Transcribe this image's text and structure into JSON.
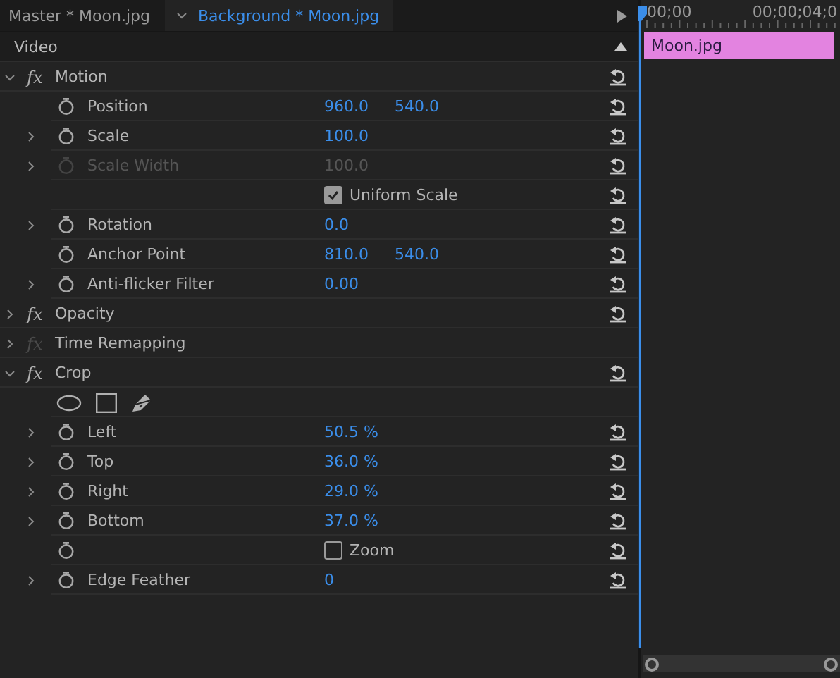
{
  "tabs": [
    {
      "label": "Master * Moon.jpg",
      "selected": false
    },
    {
      "label": "Background * Moon.jpg",
      "selected": true
    }
  ],
  "section": {
    "label": "Video"
  },
  "rows": [
    {
      "kind": "effect",
      "name": "Motion",
      "badge": "fx",
      "expanded": true,
      "fx_enabled": true,
      "reset": true
    },
    {
      "kind": "property",
      "name": "Position",
      "twirl": false,
      "values": [
        "960.0",
        "540.0"
      ],
      "reset": true
    },
    {
      "kind": "property",
      "name": "Scale",
      "twirl": true,
      "values": [
        "100.0"
      ],
      "reset": true
    },
    {
      "kind": "property",
      "name": "Scale Width",
      "twirl": true,
      "values": [
        "100.0"
      ],
      "disabled": true,
      "reset": true
    },
    {
      "kind": "checkbox",
      "label": "Uniform Scale",
      "checked": true,
      "stopwatch": false,
      "reset": true
    },
    {
      "kind": "property",
      "name": "Rotation",
      "twirl": true,
      "values": [
        "0.0"
      ],
      "reset": true
    },
    {
      "kind": "property",
      "name": "Anchor Point",
      "twirl": false,
      "values": [
        "810.0",
        "540.0"
      ],
      "reset": true
    },
    {
      "kind": "property",
      "name": "Anti-flicker Filter",
      "twirl": true,
      "values": [
        "0.00"
      ],
      "reset": true
    },
    {
      "kind": "effect",
      "name": "Opacity",
      "badge": "fx",
      "expanded": false,
      "fx_enabled": true,
      "reset": true
    },
    {
      "kind": "effect",
      "name": "Time Remapping",
      "badge": "fx",
      "expanded": false,
      "fx_enabled": false,
      "reset": false
    },
    {
      "kind": "effect",
      "name": "Crop",
      "badge": "fx",
      "expanded": true,
      "fx_enabled": true,
      "reset": true
    },
    {
      "kind": "mask_tools",
      "reset": false
    },
    {
      "kind": "property",
      "name": "Left",
      "twirl": true,
      "values": [
        "50.5 %"
      ],
      "reset": true
    },
    {
      "kind": "property",
      "name": "Top",
      "twirl": true,
      "values": [
        "36.0 %"
      ],
      "reset": true
    },
    {
      "kind": "property",
      "name": "Right",
      "twirl": true,
      "values": [
        "29.0 %"
      ],
      "reset": true
    },
    {
      "kind": "property",
      "name": "Bottom",
      "twirl": true,
      "values": [
        "37.0 %"
      ],
      "reset": true
    },
    {
      "kind": "checkbox",
      "label": "Zoom",
      "checked": false,
      "stopwatch": true,
      "reset": true
    },
    {
      "kind": "property",
      "name": "Edge Feather",
      "twirl": true,
      "values": [
        "0"
      ],
      "reset": true
    }
  ],
  "timeline": {
    "timecodes": [
      "00;00",
      "00;00;04;0"
    ],
    "clip": {
      "label": "Moon.jpg"
    }
  }
}
